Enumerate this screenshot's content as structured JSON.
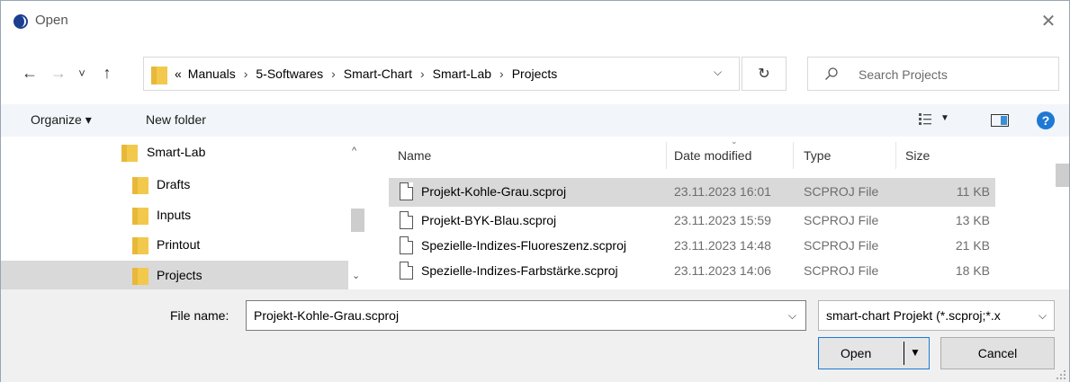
{
  "window": {
    "title": "Open",
    "close_glyph": "✕",
    "app_icon": "swirl-app-icon"
  },
  "nav": {
    "back_glyph": "←",
    "forward_glyph": "→",
    "recent_glyph": "˅",
    "up_glyph": "↑",
    "overflow": "«",
    "breadcrumbs": [
      "Manuals",
      "5-Softwares",
      "Smart-Chart",
      "Smart-Lab",
      "Projects"
    ],
    "separator": "›",
    "dropdown_glyph": "⌵",
    "refresh_glyph": "↻",
    "search_placeholder": "Search Projects"
  },
  "toolbar": {
    "organize": "Organize ▾",
    "new_folder": "New folder",
    "view_caret": "▼",
    "help": "?"
  },
  "tree": {
    "items": [
      {
        "label": "Smart-Lab",
        "level": 0,
        "selected": false
      },
      {
        "label": "Drafts",
        "level": 1,
        "selected": false
      },
      {
        "label": "Inputs",
        "level": 1,
        "selected": false
      },
      {
        "label": "Printout",
        "level": 1,
        "selected": false
      },
      {
        "label": "Projects",
        "level": 1,
        "selected": true
      }
    ],
    "scroll_up": "^",
    "scroll_down": "⌄"
  },
  "files": {
    "columns": {
      "name": "Name",
      "date": "Date modified",
      "type": "Type",
      "size": "Size"
    },
    "sort_indicator": "⌄",
    "rows": [
      {
        "name": "Projekt-Kohle-Grau.scproj",
        "date": "23.11.2023 16:01",
        "type": "SCPROJ File",
        "size": "11 KB",
        "selected": true
      },
      {
        "name": "Projekt-BYK-Blau.scproj",
        "date": "23.11.2023 15:59",
        "type": "SCPROJ File",
        "size": "13 KB",
        "selected": false
      },
      {
        "name": "Spezielle-Indizes-Fluoreszenz.scproj",
        "date": "23.11.2023 14:48",
        "type": "SCPROJ File",
        "size": "21 KB",
        "selected": false
      },
      {
        "name": "Spezielle-Indizes-Farbstärke.scproj",
        "date": "23.11.2023 14:06",
        "type": "SCPROJ File",
        "size": "18 KB",
        "selected": false
      }
    ]
  },
  "bottom": {
    "file_name_label": "File name:",
    "file_name_value": "Projekt-Kohle-Grau.scproj",
    "file_type_value": "smart-chart Projekt (*.scproj;*.x",
    "caret": "⌵",
    "open_label": "Open",
    "open_caret": "▼",
    "cancel_label": "Cancel"
  },
  "colors": {
    "accent": "#1f79d4",
    "selection": "#d9d9d9",
    "folder": "#f2c94c",
    "toolbar_bg": "#f2f5fa",
    "footer_bg": "#f0f0f0"
  }
}
